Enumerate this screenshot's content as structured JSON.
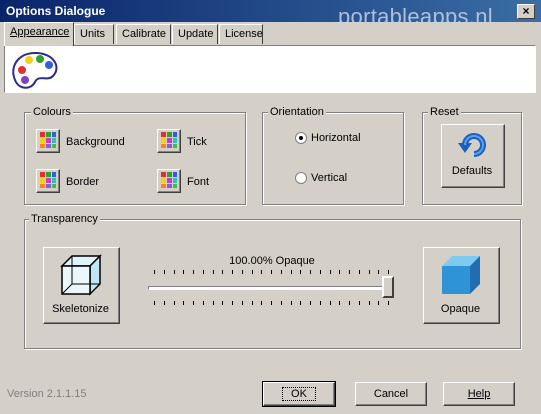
{
  "window": {
    "title": "Options Dialogue",
    "watermark": "portableapps.nl",
    "close_glyph": "×"
  },
  "tabs": [
    {
      "label": "Appearance",
      "active": true
    },
    {
      "label": "Units"
    },
    {
      "label": "Calibrate"
    },
    {
      "label": "Update"
    },
    {
      "label": "License"
    }
  ],
  "colours": {
    "group_label": "Colours",
    "items": [
      {
        "label": "Background"
      },
      {
        "label": "Tick"
      },
      {
        "label": "Border"
      },
      {
        "label": "Font"
      }
    ]
  },
  "orientation": {
    "group_label": "Orientation",
    "options": [
      {
        "label": "Horizontal",
        "selected": true
      },
      {
        "label": "Vertical",
        "selected": false
      }
    ]
  },
  "reset": {
    "group_label": "Reset",
    "defaults_label": "Defaults"
  },
  "transparency": {
    "group_label": "Transparency",
    "skeletonize_label": "Skeletonize",
    "opaque_label": "Opaque",
    "value_text": "100.00% Opaque",
    "slider_value": 1.0
  },
  "footer": {
    "version": "Version 2.1.1.15",
    "ok_label": "OK",
    "cancel_label": "Cancel",
    "help_label": "Help"
  },
  "icons": {
    "palette": "palette-icon",
    "swatch": "color-swatch-icon",
    "defaults": "reset-arrow-icon",
    "skeleton": "wireframe-cube-icon",
    "opaque": "solid-cube-icon"
  }
}
